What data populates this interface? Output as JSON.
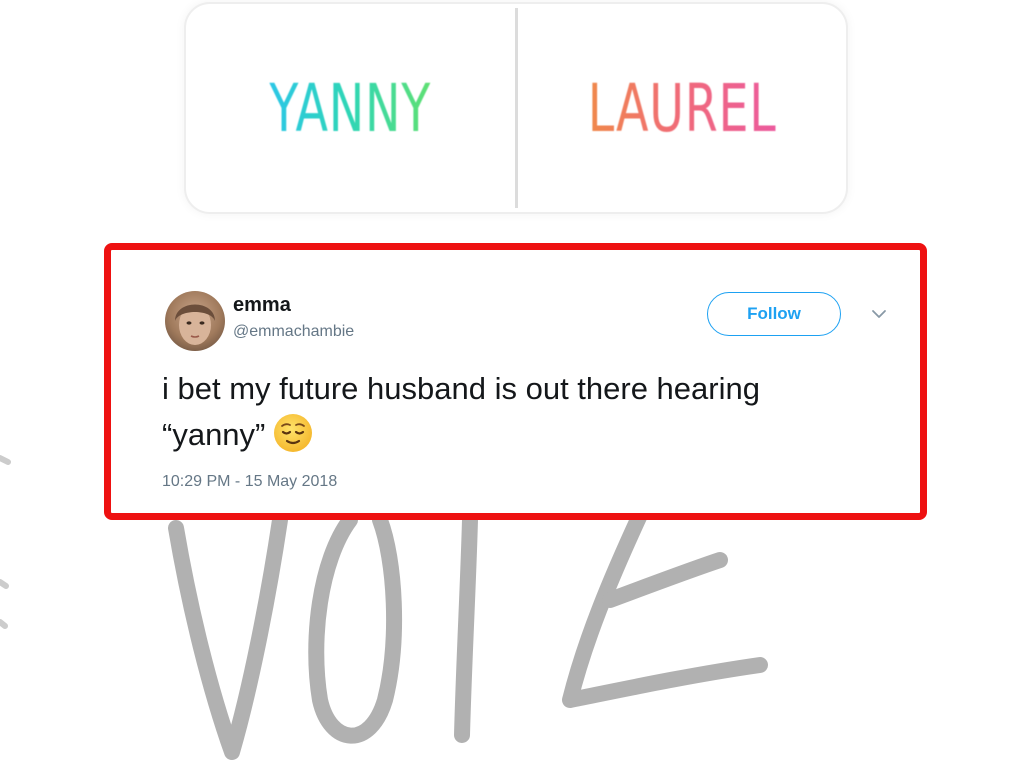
{
  "poll": {
    "option_left": "YANNY",
    "option_right": "LAUREL"
  },
  "background_text": "VOTE",
  "tweet": {
    "display_name": "emma",
    "handle": "@emmachambie",
    "follow_label": "Follow",
    "text_line1": "i bet my future husband is out there hearing",
    "text_line2": "“yanny”",
    "emoji": "relieved-face",
    "timestamp": "10:29 PM - 15 May 2018"
  },
  "colors": {
    "highlight_border": "#ee1111",
    "twitter_blue": "#1da1f2",
    "text_primary": "#14171a",
    "text_secondary": "#657786",
    "vote_stroke": "#a9a9a9"
  }
}
